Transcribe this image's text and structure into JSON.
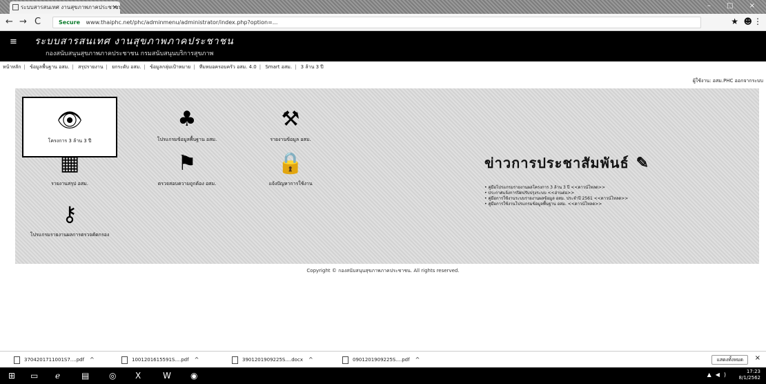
{
  "browser": {
    "tab_title": "ระบบสารสนเทศ งานสุขภาพภาคประชาชน",
    "tab_close": "×",
    "window_buttons": "– □ ×",
    "back": "←",
    "forward": "→",
    "reload": "C",
    "secure_label": "Secure",
    "url": "www.thaiphc.net/phc/adminmenu/administrator/index.php?option=...",
    "star": "★",
    "account": "☻",
    "menu": "⋮"
  },
  "site": {
    "logo": "≡",
    "title": "ระบบสารสนเทศ งานสุขภาพภาคประชาชน",
    "subtitle": "กองสนับสนุนสุขภาพภาคประชาชน กรมสนับสนุนบริการสุขภาพ"
  },
  "toolbar": {
    "links": [
      "หน้าหลัก",
      "ข้อมูลพื้นฐาน อสม.",
      "สรุปรายงาน",
      "ยกระดับ อสม.",
      "ข้อมูลกลุ่มเป้าหมาย",
      "ทีมหมอครอบครัว อสม. 4.0",
      "Smart อสม.",
      "3 ล้าน 3 ปี"
    ],
    "user_info": "ผู้ใช้งาน: อสม.PHC ออกจากระบบ"
  },
  "apps": [
    {
      "label": "โครงการ 3 ล้าน 3 ปี",
      "icon": "eye-badge-icon"
    },
    {
      "label": "โปรแกรมข้อมูลพื้นฐาน อสม.",
      "icon": "people-tree-icon"
    },
    {
      "label": "รายงานข้อมูล อสม.",
      "icon": "tools-icon"
    },
    {
      "label": "รายงานสรุป อสม.",
      "icon": "certificate-icon"
    },
    {
      "label": "ตรวจสอบความถูกต้อง อสม.",
      "icon": "volunteers-icon"
    },
    {
      "label": "แจ้งปัญหาการใช้งาน",
      "icon": "lock-laptop-icon"
    },
    {
      "label": "โปรแกรมรายงานผลการตรวจคัดกรอง",
      "icon": "key-people-icon"
    }
  ],
  "news": {
    "heading": "ข่าวการประชาสัมพันธ์",
    "pen": "✎",
    "items": [
      "คู่มือโปรแกรมรายงานผลโครงการ 3 ล้าน 3 ปี <<ดาวน์โหลด>>",
      "ประกาศแจ้งการปิดปรับปรุงระบบ <<อ่านต่อ>>",
      "คู่มือการใช้งานระบบรายงานผลข้อมูล อสม. ประจำปี 2561 <<ดาวน์โหลด>>",
      "คู่มือการใช้งานโปรแกรมข้อมูลพื้นฐาน อสม. <<ดาวน์โหลด>>"
    ]
  },
  "copyright": "Copyright © กองสนับสนุนสุขภาพภาคประชาชน. All rights reserved.",
  "downloads": {
    "items": [
      "3704201711001S7....pdf",
      "1001201615591S....pdf",
      "3901201909225S....docx",
      "0901201909225S....pdf"
    ],
    "caret": "^",
    "show_all": "แสดงทั้งหมด",
    "close": "×"
  },
  "taskbar": {
    "start": "⊞",
    "time": "17:23",
    "date": "8/1/2562"
  }
}
